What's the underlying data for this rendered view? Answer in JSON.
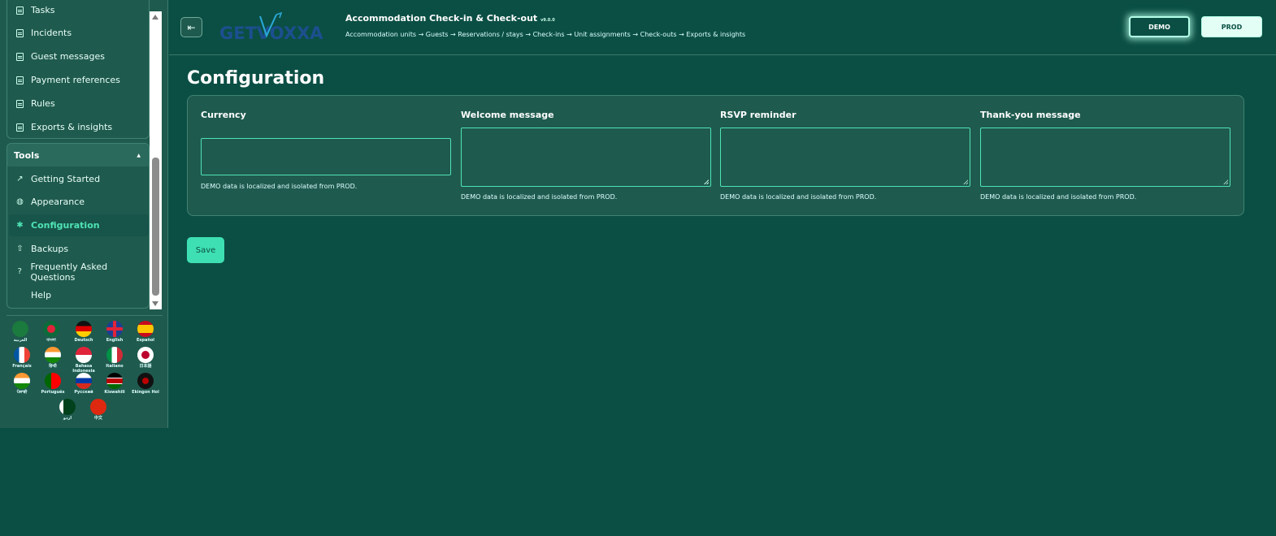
{
  "sidebar": {
    "partial_top_item": "Tasks",
    "top_items": [
      {
        "label": "Incidents",
        "icon": "document-icon"
      },
      {
        "label": "Guest messages",
        "icon": "document-icon"
      },
      {
        "label": "Payment references",
        "icon": "document-icon"
      },
      {
        "label": "Rules",
        "icon": "document-icon"
      },
      {
        "label": "Exports & insights",
        "icon": "document-icon"
      }
    ],
    "tools_header": "Tools",
    "tools_items": [
      {
        "label": "Getting Started",
        "icon": "external-link-icon"
      },
      {
        "label": "Appearance",
        "icon": "palette-icon"
      },
      {
        "label": "Configuration",
        "icon": "gear-icon",
        "active": true
      },
      {
        "label": "Backups",
        "icon": "upload-icon"
      },
      {
        "label": "Frequently Asked Questions",
        "icon": "help-circle-icon"
      },
      {
        "label": "Help",
        "icon": ""
      }
    ],
    "languages": [
      {
        "label": "العربية",
        "flag": "saudi-arabia"
      },
      {
        "label": "বাংলা",
        "flag": "bangladesh"
      },
      {
        "label": "Deutsch",
        "flag": "germany"
      },
      {
        "label": "English",
        "flag": "uk"
      },
      {
        "label": "Español",
        "flag": "spain"
      },
      {
        "label": "Français",
        "flag": "france"
      },
      {
        "label": "हिन्दी",
        "flag": "india"
      },
      {
        "label": "Bahasa Indonesia",
        "flag": "indonesia"
      },
      {
        "label": "Italiano",
        "flag": "italy"
      },
      {
        "label": "日本語",
        "flag": "japan"
      },
      {
        "label": "ਪੰਜਾਬੀ",
        "flag": "india"
      },
      {
        "label": "Português",
        "flag": "portugal"
      },
      {
        "label": "Русский",
        "flag": "russia"
      },
      {
        "label": "Kiswahili",
        "flag": "kenya"
      },
      {
        "label": "Ekingon Hol",
        "flag": "klingon"
      },
      {
        "label": "اردو",
        "flag": "pakistan"
      },
      {
        "label": "中文",
        "flag": "china"
      }
    ]
  },
  "header": {
    "logo_text": "GETVOXXA",
    "title": "Accommodation Check-in & Check-out",
    "version": "v9.0.0",
    "subtitle": "Accommodation units → Guests → Reservations / stays → Check-ins → Unit assignments → Check-outs → Exports & insights",
    "demo_label": "DEMO",
    "prod_label": "PROD"
  },
  "main": {
    "page_title": "Configuration",
    "fields": [
      {
        "label": "Currency",
        "value": "",
        "hint": "DEMO data is localized and isolated from PROD."
      },
      {
        "label": "Welcome message",
        "value": "",
        "hint": "DEMO data is localized and isolated from PROD."
      },
      {
        "label": "RSVP reminder",
        "value": "",
        "hint": "DEMO data is localized and isolated from PROD."
      },
      {
        "label": "Thank-you message",
        "value": "",
        "hint": "DEMO data is localized and isolated from PROD."
      }
    ],
    "save_label": "Save"
  },
  "colors": {
    "background": "#0b4f44",
    "panel": "#1f5a4e",
    "accent": "#4ee3b5",
    "save_button": "#3ee0b3"
  }
}
